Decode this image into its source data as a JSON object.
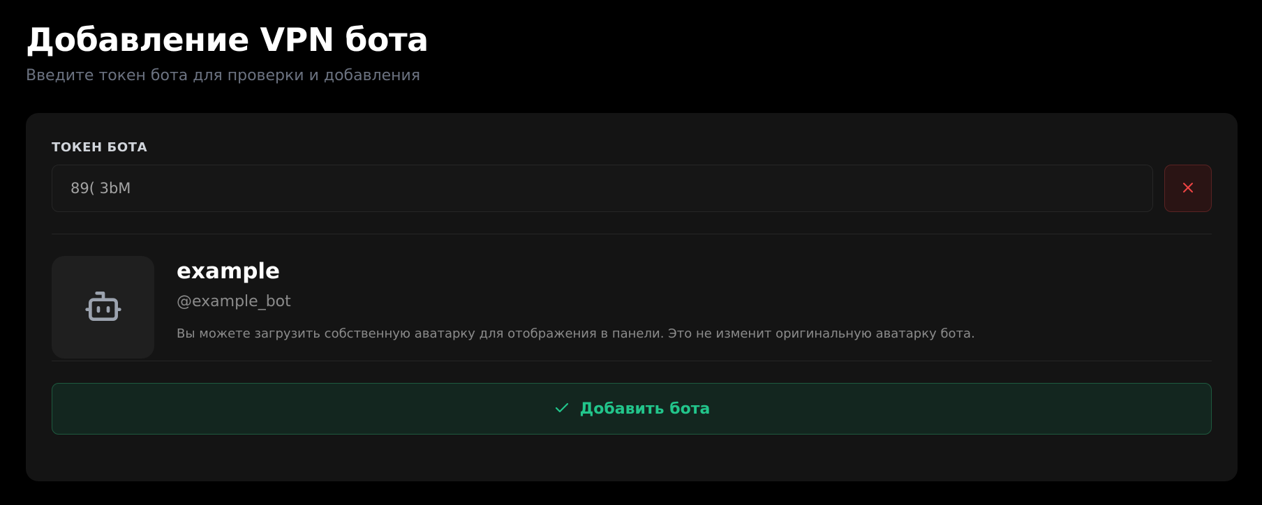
{
  "header": {
    "title": "Добавление VPN бота",
    "subtitle": "Введите токен бота для проверки и добавления"
  },
  "token_field": {
    "label": "ТОКЕН БОТА",
    "value": "89( 3bM",
    "clear_icon": "close-icon"
  },
  "bot": {
    "avatar_icon": "bot-icon",
    "name": "example",
    "username": "@example_bot",
    "hint": "Вы можете загрузить собственную аватарку для отображения в панели. Это не изменит оригинальную аватарку бота."
  },
  "actions": {
    "add_label": "Добавить бота",
    "add_icon": "check-icon"
  },
  "colors": {
    "background": "#000000",
    "card": "#141414",
    "accent_green": "#22c58b",
    "danger_red": "#ef4444",
    "muted_text": "#6b7280"
  }
}
